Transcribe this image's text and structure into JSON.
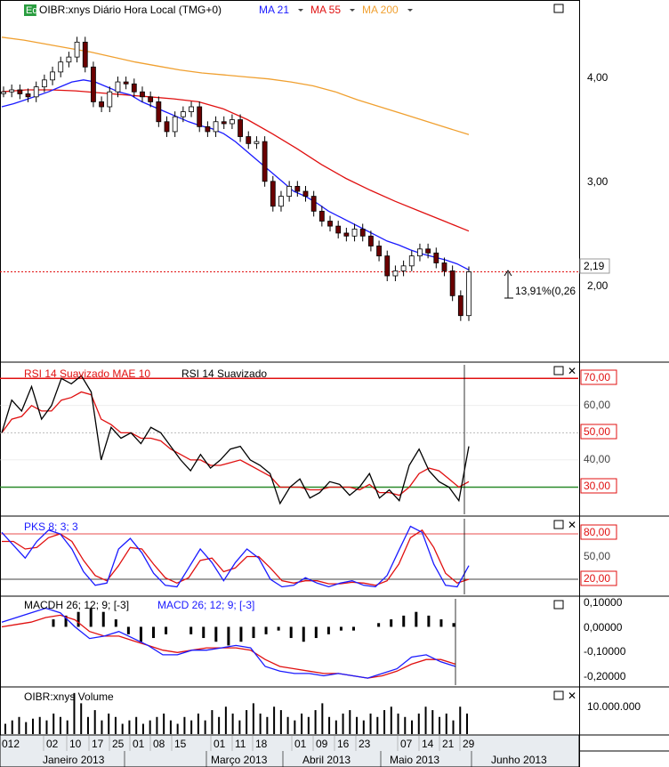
{
  "header": {
    "symbol_badge": "Eq",
    "symbol": "OIBR:xnys Diário Hora Local (TMG+0)",
    "ma21": "MA 21",
    "ma55": "MA 55",
    "ma200": "MA 200"
  },
  "price_label": "2,19",
  "change_label": "13,91%(0,26",
  "rsi": {
    "title_mae": "RSI 14 Suavizado MAE 10",
    "title": "RSI 14 Suavizado",
    "levels": [
      "70,00",
      "60,00",
      "50,00",
      "40,00",
      "30,00"
    ]
  },
  "pks": {
    "title": "PKS 8; 3; 3",
    "levels": [
      "80,00",
      "50,00",
      "20,00"
    ]
  },
  "macd": {
    "title_h": "MACDH 26; 12; 9; [-3]",
    "title": "MACD 26; 12; 9; [-3]",
    "levels": [
      "0,10000",
      "0,00000",
      "-0,10000",
      "-0,20000"
    ]
  },
  "volume": {
    "title": "OIBR:xnys Volume",
    "level": "10.000.000"
  },
  "xaxis": {
    "days": [
      "012",
      "02",
      "10",
      "17",
      "25",
      "01",
      "08",
      "15",
      "01",
      "11",
      "18",
      "01",
      "09",
      "16",
      "23",
      "07",
      "14",
      "21",
      "29"
    ],
    "months": [
      "Janeiro 2013",
      "Março 2013",
      "Abril 2013",
      "Maio 2013",
      "Junho 2013"
    ]
  },
  "colors": {
    "ma21": "#1a1aff",
    "ma55": "#e01010",
    "ma200": "#f0a030",
    "rsi": "#000000",
    "rsi_mae": "#e01010",
    "k": "#1a1aff",
    "d": "#e01010"
  },
  "chart_data": {
    "type": "line",
    "price_axis": [
      "4,00",
      "3,00",
      "2,00"
    ],
    "price_ylim": [
      1.3,
      4.7
    ],
    "price_close": [
      4.0,
      4.02,
      3.98,
      3.95,
      4.05,
      4.12,
      4.2,
      4.3,
      4.35,
      4.5,
      4.25,
      3.9,
      3.85,
      4.0,
      4.1,
      4.08,
      4.0,
      3.95,
      3.9,
      3.7,
      3.6,
      3.75,
      3.8,
      3.85,
      3.65,
      3.6,
      3.7,
      3.68,
      3.72,
      3.55,
      3.48,
      3.5,
      3.1,
      2.85,
      2.95,
      3.05,
      3.0,
      2.95,
      2.8,
      2.7,
      2.65,
      2.58,
      2.55,
      2.62,
      2.55,
      2.45,
      2.35,
      2.15,
      2.2,
      2.25,
      2.35,
      2.42,
      2.38,
      2.28,
      2.2,
      1.95,
      1.75,
      2.19
    ],
    "ma21": [
      3.85,
      3.88,
      3.92,
      3.96,
      4.0,
      4.05,
      4.1,
      4.12,
      4.1,
      4.05,
      4.0,
      3.97,
      3.9,
      3.85,
      3.8,
      3.75,
      3.7,
      3.66,
      3.63,
      3.58,
      3.5,
      3.4,
      3.3,
      3.2,
      3.1,
      3.0,
      2.95,
      2.88,
      2.8,
      2.74,
      2.68,
      2.62,
      2.56,
      2.5,
      2.46,
      2.41,
      2.37,
      2.34,
      2.31,
      2.27,
      2.21
    ],
    "ma55": [
      4.0,
      4.02,
      4.02,
      4.01,
      3.99,
      3.97,
      3.95,
      3.93,
      3.9,
      3.83,
      3.72,
      3.58,
      3.43,
      3.27,
      3.13,
      3.01,
      2.9,
      2.8,
      2.7,
      2.6
    ],
    "ma200": [
      4.55,
      4.52,
      4.48,
      4.44,
      4.4,
      4.35,
      4.3,
      4.26,
      4.22,
      4.19,
      4.17,
      4.15,
      4.13,
      4.1,
      4.06,
      4.0,
      3.92,
      3.85,
      3.78,
      3.71,
      3.64,
      3.57
    ],
    "current_price": 2.19,
    "rsi_ylim": [
      20,
      75
    ],
    "rsi": [
      50,
      62,
      58,
      67,
      55,
      60,
      70,
      68,
      71,
      65,
      40,
      52,
      48,
      50,
      46,
      52,
      50,
      45,
      40,
      36,
      42,
      37,
      40,
      44,
      45,
      40,
      38,
      35,
      24,
      30,
      33,
      26,
      28,
      32,
      31,
      27,
      30,
      35,
      26,
      29,
      25,
      38,
      44,
      36,
      32,
      30,
      25,
      45
    ],
    "rsi_mae": [
      50,
      55,
      56,
      60,
      58,
      58,
      62,
      63,
      65,
      64,
      55,
      53,
      50,
      50,
      48,
      48,
      47,
      44,
      42,
      40,
      40,
      38,
      38,
      39,
      40,
      38,
      36,
      34,
      30,
      30,
      30,
      29,
      29,
      30,
      30,
      30,
      29,
      31,
      28,
      28,
      27,
      30,
      35,
      37,
      36,
      33,
      30,
      32
    ],
    "pks_ylim": [
      0,
      100
    ],
    "pks_k": [
      82,
      65,
      48,
      70,
      85,
      80,
      60,
      30,
      12,
      15,
      60,
      74,
      55,
      28,
      12,
      10,
      35,
      60,
      42,
      18,
      42,
      60,
      48,
      20,
      10,
      12,
      22,
      15,
      10,
      15,
      18,
      12,
      10,
      25,
      58,
      90,
      82,
      40,
      12,
      10,
      38
    ],
    "pks_d": [
      70,
      70,
      60,
      62,
      75,
      80,
      70,
      45,
      25,
      18,
      38,
      62,
      60,
      40,
      22,
      15,
      22,
      45,
      48,
      30,
      35,
      50,
      50,
      35,
      18,
      15,
      18,
      18,
      14,
      14,
      16,
      15,
      12,
      18,
      40,
      75,
      85,
      62,
      28,
      15,
      20
    ],
    "macd_ylim": [
      -0.25,
      0.12
    ],
    "macd_line": [
      0.02,
      0.04,
      0.06,
      0.08,
      0.06,
      0.0,
      -0.05,
      -0.04,
      -0.02,
      -0.05,
      -0.08,
      -0.12,
      -0.12,
      -0.1,
      -0.1,
      -0.09,
      -0.08,
      -0.09,
      -0.17,
      -0.19,
      -0.2,
      -0.2,
      -0.21,
      -0.2,
      -0.21,
      -0.22,
      -0.2,
      -0.18,
      -0.13,
      -0.12,
      -0.15,
      -0.17
    ],
    "macd_signal": [
      0.0,
      0.01,
      0.02,
      0.04,
      0.05,
      0.03,
      -0.02,
      -0.04,
      -0.04,
      -0.06,
      -0.08,
      -0.1,
      -0.11,
      -0.1,
      -0.09,
      -0.09,
      -0.09,
      -0.1,
      -0.14,
      -0.17,
      -0.18,
      -0.19,
      -0.2,
      -0.2,
      -0.21,
      -0.22,
      -0.21,
      -0.19,
      -0.16,
      -0.14,
      -0.14,
      -0.16
    ],
    "macd_hist": [
      0.02,
      0.03,
      0.04,
      0.05,
      0.04,
      0.02,
      -0.02,
      -0.04,
      -0.03,
      -0.02,
      0.0,
      -0.02,
      -0.03,
      -0.04,
      -0.05,
      -0.04,
      -0.03,
      -0.02,
      -0.01,
      -0.03,
      -0.04,
      -0.03,
      -0.02,
      -0.01,
      -0.01,
      0.0,
      0.01,
      0.02,
      0.03,
      0.04,
      0.03,
      0.02,
      0.01
    ],
    "volume_ylim": [
      0,
      13000000
    ],
    "volume": [
      3000000.0,
      4000000.0,
      5000000.0,
      3500000.0,
      4500000.0,
      5000000.0,
      4000000.0,
      6000000.0,
      5000000.0,
      4000000.0,
      12000000.0,
      9000000.0,
      5000000.0,
      7000000.0,
      4000000.0,
      6000000.0,
      5000000.0,
      3000000.0,
      4000000.0,
      5000000.0,
      3000000.0,
      4000000.0,
      5000000.0,
      6000000.0,
      4000000.0,
      3000000.0,
      5000000.0,
      4000000.0,
      6000000.0,
      4000000.0,
      7000000.0,
      5000000.0,
      8000000.0,
      6000000.0,
      4000000.0,
      7000000.0,
      9000000.0,
      6000000.0,
      5000000.0,
      8000000.0,
      7000000.0,
      5000000.0,
      4000000.0,
      6000000.0,
      5000000.0,
      7000000.0,
      9000000.0,
      5000000.0,
      4000000.0,
      6000000.0,
      7000000.0,
      5000000.0,
      4000000.0,
      6000000.0,
      5000000.0,
      7000000.0,
      8000000.0,
      6000000.0,
      5000000.0,
      4000000.0,
      6000000.0,
      8000000.0,
      7000000.0,
      5000000.0,
      6000000.0,
      4000000.0,
      8000000.0,
      6000000.0
    ]
  }
}
